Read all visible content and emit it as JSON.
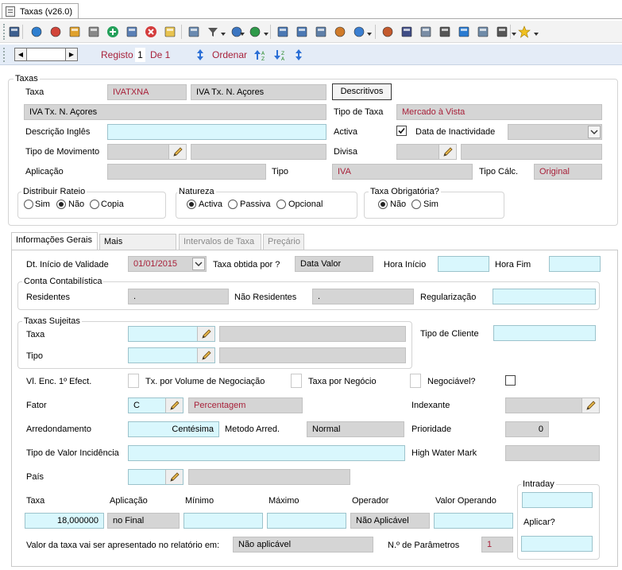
{
  "window": {
    "tab_title": "Taxas (v26.0)"
  },
  "nav": {
    "registo_label": "Registo",
    "registo_value": "1",
    "de_label": "De 1",
    "ordenar_label": "Ordenar"
  },
  "taxas": {
    "group_label": "Taxas",
    "taxa_label": "Taxa",
    "taxa_code": "IVATXNA",
    "taxa_name": "IVA Tx. N. Açores",
    "descritivos_button": "Descritivos",
    "descricao_value": "IVA Tx. N. Açores",
    "tipo_taxa_label": "Tipo de Taxa",
    "tipo_taxa_value": "Mercado à Vista",
    "descricao_ingles_label": "Descrição Inglês",
    "activa_label": "Activa",
    "data_inactividade_label": "Data de Inactividade",
    "tipo_movimento_label": "Tipo de Movimento",
    "divisa_label": "Divisa",
    "aplicacao_label": "Aplicação",
    "tipo_label": "Tipo",
    "tipo_value": "IVA",
    "tipo_calc_label": "Tipo Cálc.",
    "tipo_calc_value": "Original"
  },
  "distribuir": {
    "label": "Distribuir Rateio",
    "opt1": "Sim",
    "opt2": "Não",
    "opt3": "Copia"
  },
  "natureza": {
    "label": "Natureza",
    "opt1": "Activa",
    "opt2": "Passiva",
    "opt3": "Opcional"
  },
  "obrigatoria": {
    "label": "Taxa Obrigatória?",
    "opt1": "Não",
    "opt2": "Sim"
  },
  "tabs": [
    "Informações Gerais",
    "Mais Informações",
    "Intervalos de Taxa",
    "Preçário"
  ],
  "gerais": {
    "dt_inicio_label": "Dt. Início de Validade",
    "dt_inicio_value": "01/01/2015",
    "taxa_obtida_label": "Taxa obtida por ?",
    "taxa_obtida_value": "Data Valor",
    "hora_inicio_label": "Hora Início",
    "hora_fim_label": "Hora Fim",
    "conta_label": "Conta Contabilística",
    "residentes_label": "Residentes",
    "residentes_value": ".",
    "nao_residentes_label": "Não Residentes",
    "nao_residentes_value": ".",
    "regularizacao_label": "Regularização",
    "sujeitas_label": "Taxas Sujeitas",
    "suj_taxa_label": "Taxa",
    "suj_tipo_label": "Tipo",
    "tipo_cliente_label": "Tipo de Cliente",
    "vl_enc_label": "Vl. Enc. 1º Efect.",
    "tx_volume_label": "Tx. por Volume de Negociação",
    "taxa_negocio_label": "Taxa por Negócio",
    "negociavel_label": "Negociável?",
    "fator_label": "Fator",
    "fator_value": "C",
    "fator_desc": "Percentagem",
    "indexante_label": "Indexante",
    "arred_label": "Arredondamento",
    "arred_value": "Centésima",
    "metodo_label": "Metodo Arred.",
    "metodo_value": "Normal",
    "prioridade_label": "Prioridade",
    "prioridade_value": "0",
    "tipo_valor_label": "Tipo de Valor Incidência",
    "hwm_label": "High Water Mark",
    "pais_label": "País",
    "col_taxa": "Taxa",
    "col_aplicacao": "Aplicação",
    "col_minimo": "Mínimo",
    "col_maximo": "Máximo",
    "col_operador": "Operador",
    "col_valor_operando": "Valor Operando",
    "val_taxa": "18,000000",
    "val_aplicacao": "no Final",
    "val_operador": "Não Aplicável",
    "relatorio_label": "Valor da taxa vai ser apresentado no relatório em:",
    "relatorio_value": "Não aplicável",
    "n_param_label": "N.º de Parâmetros",
    "n_param_value": "1",
    "intraday_label": "Intraday",
    "aplicar_label": "Aplicar?"
  }
}
